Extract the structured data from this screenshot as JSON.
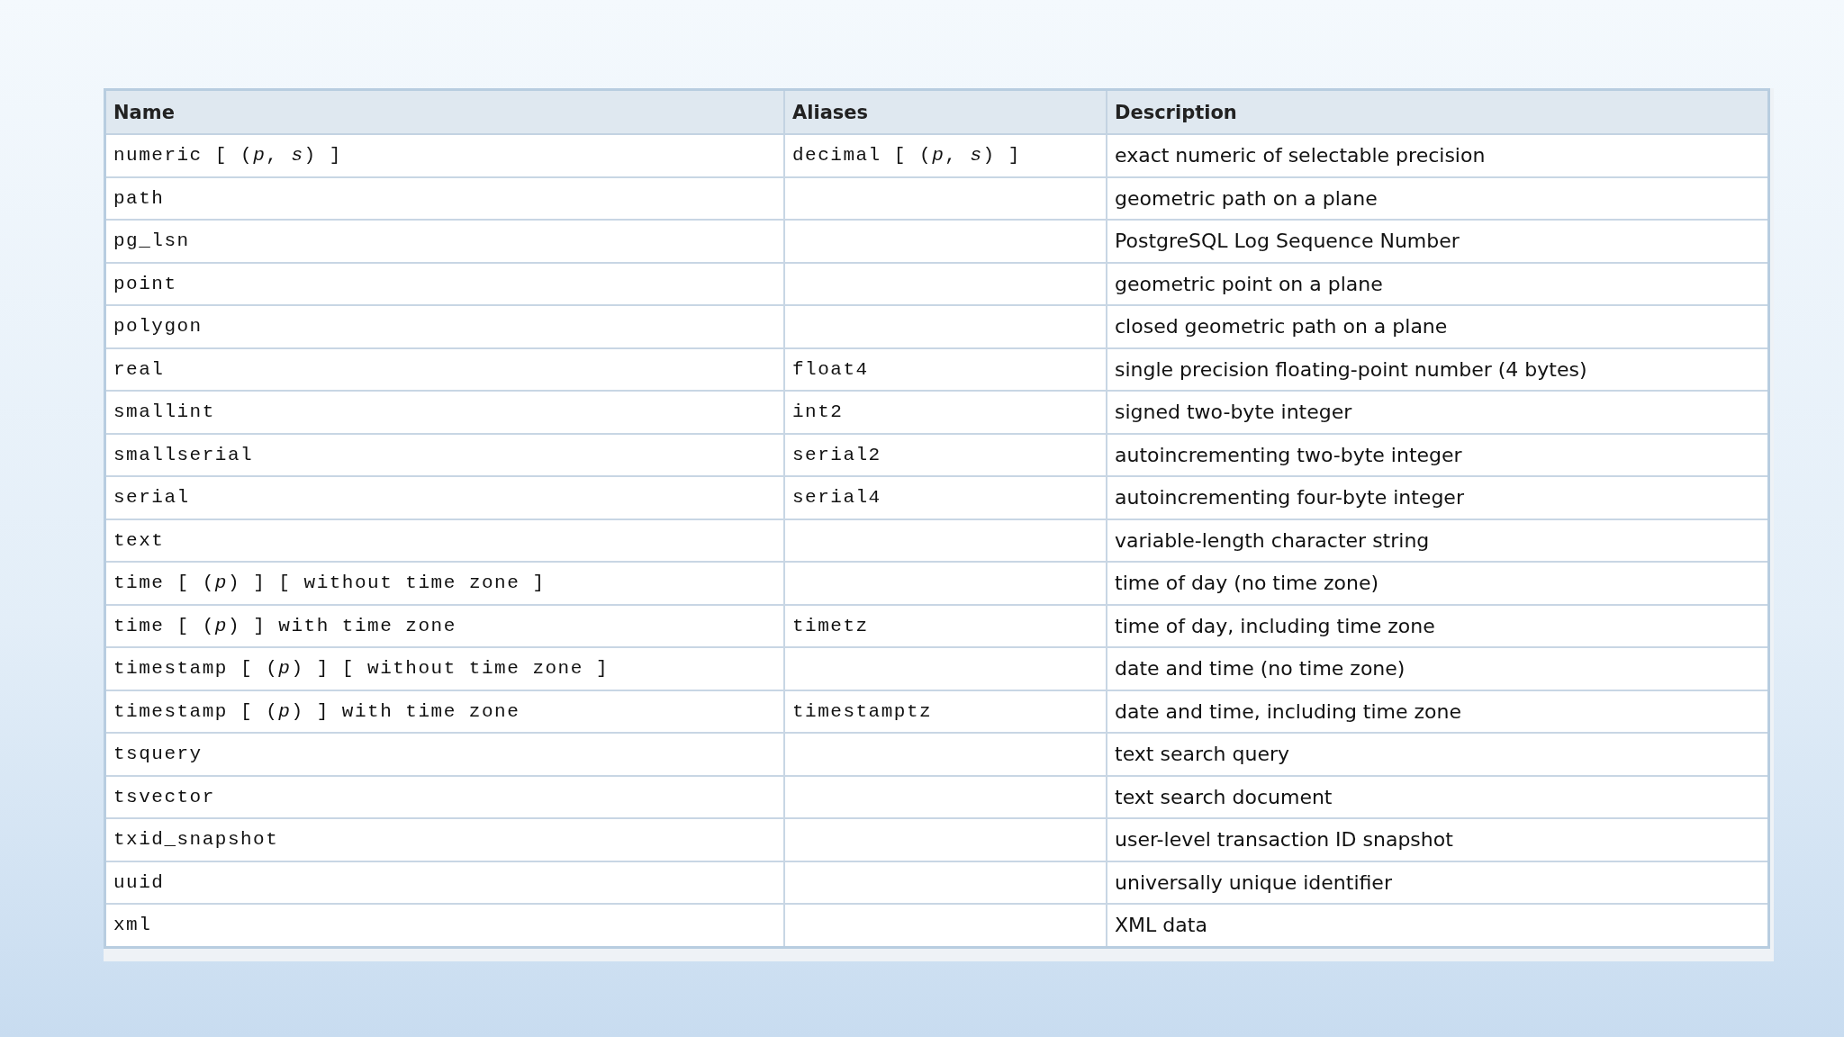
{
  "table": {
    "columns": [
      "Name",
      "Aliases",
      "Description"
    ],
    "rows": [
      {
        "name": "numeric [ (*p*, *s*) ]",
        "aliases": "decimal [ (*p*, *s*) ]",
        "description": "exact numeric of selectable precision"
      },
      {
        "name": "path",
        "aliases": "",
        "description": "geometric path on a plane"
      },
      {
        "name": "pg_lsn",
        "aliases": "",
        "description": "PostgreSQL Log Sequence Number"
      },
      {
        "name": "point",
        "aliases": "",
        "description": "geometric point on a plane"
      },
      {
        "name": "polygon",
        "aliases": "",
        "description": "closed geometric path on a plane"
      },
      {
        "name": "real",
        "aliases": "float4",
        "description": "single precision floating-point number (4 bytes)"
      },
      {
        "name": "smallint",
        "aliases": "int2",
        "description": "signed two-byte integer"
      },
      {
        "name": "smallserial",
        "aliases": "serial2",
        "description": "autoincrementing two-byte integer"
      },
      {
        "name": "serial",
        "aliases": "serial4",
        "description": "autoincrementing four-byte integer"
      },
      {
        "name": "text",
        "aliases": "",
        "description": "variable-length character string"
      },
      {
        "name": "time [ (*p*) ] [ without time zone ]",
        "aliases": "",
        "description": "time of day (no time zone)"
      },
      {
        "name": "time [ (*p*) ] with time zone",
        "aliases": "timetz",
        "description": "time of day, including time zone"
      },
      {
        "name": "timestamp [ (*p*) ] [ without time zone ]",
        "aliases": "",
        "description": "date and time (no time zone)"
      },
      {
        "name": "timestamp [ (*p*) ] with time zone",
        "aliases": "timestamptz",
        "description": "date and time, including time zone"
      },
      {
        "name": "tsquery",
        "aliases": "",
        "description": "text search query"
      },
      {
        "name": "tsvector",
        "aliases": "",
        "description": "text search document"
      },
      {
        "name": "txid_snapshot",
        "aliases": "",
        "description": "user-level transaction ID snapshot"
      },
      {
        "name": "uuid",
        "aliases": "",
        "description": "universally unique identifier"
      },
      {
        "name": "xml",
        "aliases": "",
        "description": "XML data"
      }
    ]
  }
}
